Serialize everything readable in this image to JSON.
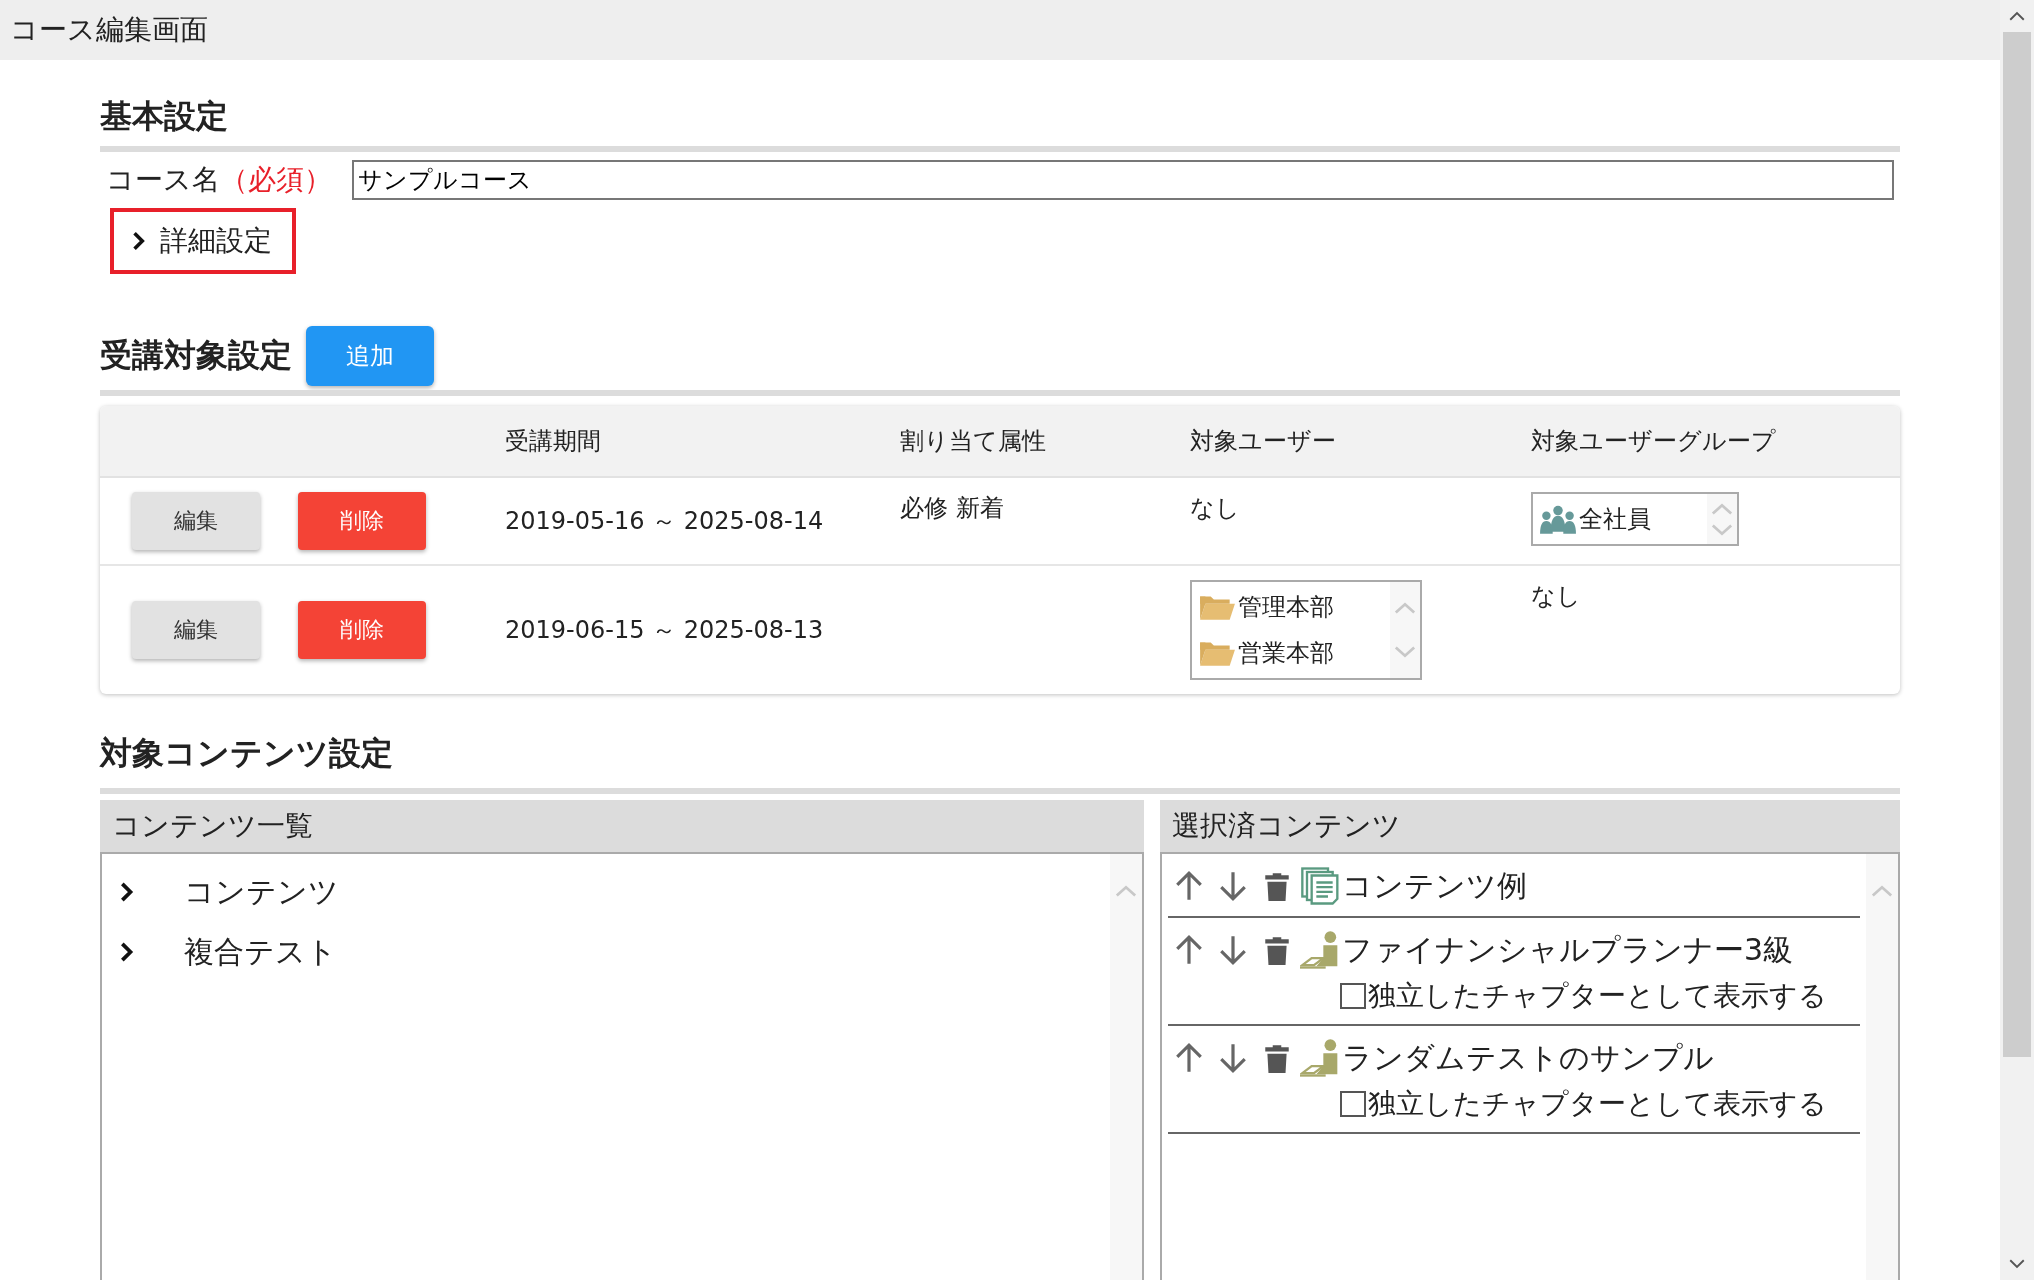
{
  "window": {
    "title": "コース編集画面"
  },
  "basic_settings": {
    "heading": "基本設定",
    "course_name": {
      "label": "コース名",
      "required_mark": "（必須）",
      "value": "サンプルコース"
    },
    "details_toggle": {
      "label": "詳細設定",
      "expanded": false
    }
  },
  "target_settings": {
    "heading": "受講対象設定",
    "add_button": "追加",
    "table": {
      "columns": [
        "受講期間",
        "割り当て属性",
        "対象ユーザー",
        "対象ユーザーグループ"
      ],
      "rows": [
        {
          "edit_button": "編集",
          "delete_button": "削除",
          "period": "2019-05-16 ～ 2025-08-14",
          "attributes": "必修 新着",
          "users": {
            "kind": "text",
            "text": "なし"
          },
          "groups": {
            "kind": "list",
            "items": [
              {
                "kind": "group",
                "label": "全社員"
              }
            ]
          }
        },
        {
          "edit_button": "編集",
          "delete_button": "削除",
          "period": "2019-06-15 ～ 2025-08-13",
          "users": {
            "kind": "list",
            "items": [
              {
                "kind": "folder",
                "label": "管理本部"
              },
              {
                "kind": "folder",
                "label": "営業本部"
              }
            ]
          },
          "groups": {
            "kind": "text",
            "text": "なし"
          }
        }
      ]
    }
  },
  "content_settings": {
    "heading": "対象コンテンツ設定",
    "content_list": {
      "title": "コンテンツ一覧",
      "items": [
        {
          "label": "コンテンツ",
          "expanded": false
        },
        {
          "label": "複合テスト",
          "expanded": false
        }
      ]
    },
    "selected_contents": {
      "title": "選択済コンテンツ",
      "items": [
        {
          "kind": "document",
          "label": "コンテンツ例"
        },
        {
          "kind": "test",
          "label": "ファイナンシャルプランナー3級",
          "chapter_option": {
            "label": "独立したチャプターとして表示する",
            "checked": false
          }
        },
        {
          "kind": "test",
          "label": "ランダムテストのサンプル",
          "chapter_option": {
            "label": "独立したチャプターとして表示する",
            "checked": false
          }
        }
      ]
    }
  }
}
